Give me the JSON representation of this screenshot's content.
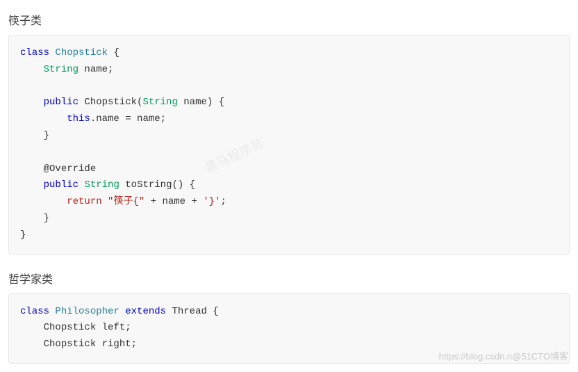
{
  "section1": {
    "title": "筷子类"
  },
  "code1": {
    "l1_kw": "class",
    "l1_cls": "Chopstick",
    "l2_type": "String",
    "l2_name": " name;",
    "l4_mod": "public",
    "l4_ctor": " Chopstick(",
    "l4_ptype": "String",
    "l4_pname": " name) {",
    "l5_this": "this",
    "l5_rest": ".name = name;",
    "l8_ann": "@Override",
    "l9_mod": "public",
    "l9_sp": " ",
    "l9_type": "String",
    "l9_fn": " toString() {",
    "l10_ret": "return",
    "l10_sp": " ",
    "l10_s1": "\"筷子{\"",
    "l10_plus1": " + name + ",
    "l10_s2": "'}'",
    "l10_semi": ";"
  },
  "section2": {
    "title": "哲学家类"
  },
  "code2": {
    "l1_kw": "class",
    "l1_cls": "Philosopher",
    "l1_ext": "extends",
    "l1_super": "Thread",
    "l2_type": "Chopstick left;",
    "l3_type": "Chopstick right;"
  },
  "watermark": {
    "center": "黑马程序员",
    "footer": "https://blog.csdn.n@51CTO博客"
  }
}
